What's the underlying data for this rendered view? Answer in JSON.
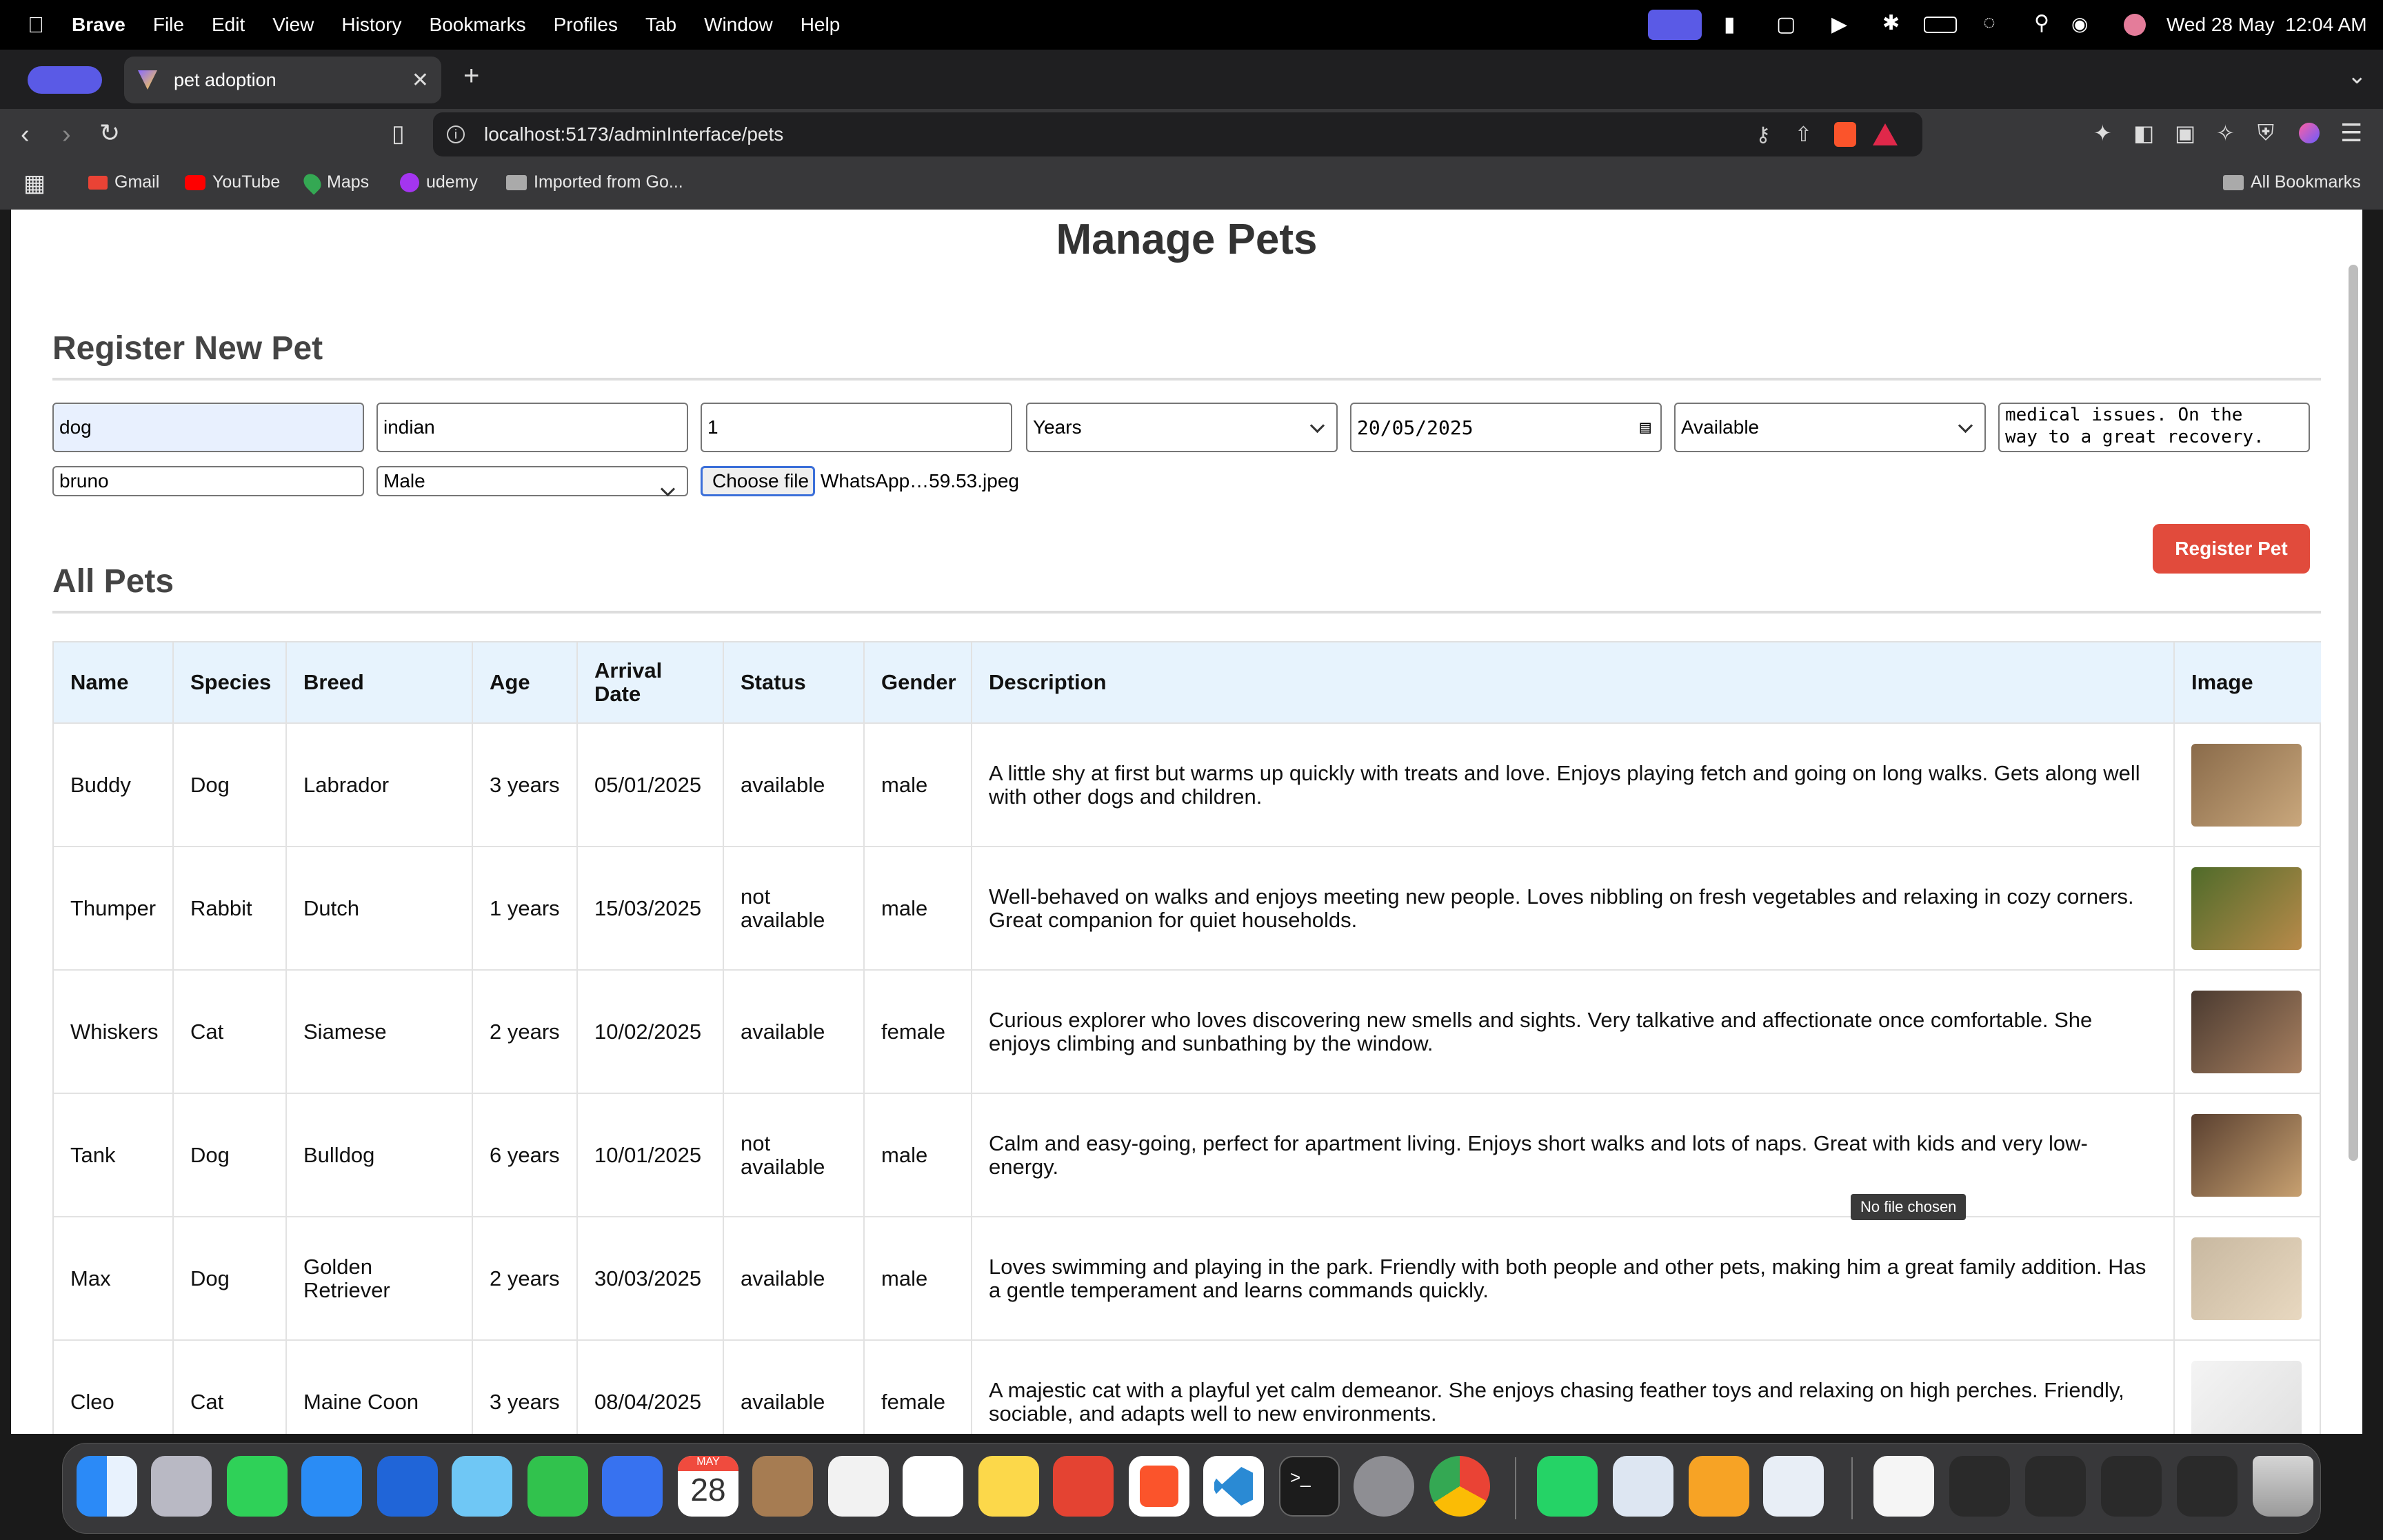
{
  "menubar": {
    "app": "Brave",
    "menus": [
      "File",
      "Edit",
      "View",
      "History",
      "Bookmarks",
      "Profiles",
      "Tab",
      "Window",
      "Help"
    ],
    "clock": "Wed 28 May  12:04 AM"
  },
  "tab": {
    "title": "pet adoption"
  },
  "url": "localhost:5173/adminInterface/pets",
  "bookmarks": [
    "Gmail",
    "YouTube",
    "Maps",
    "udemy",
    "Imported from Go...",
    "All Bookmarks"
  ],
  "page": {
    "title": "Manage Pets",
    "register_heading": "Register New Pet",
    "all_heading": "All Pets",
    "register_button": "Register Pet"
  },
  "form": {
    "species": "dog",
    "breed": "indian",
    "age": "1",
    "age_unit": "Years",
    "arrival": "20/05/2025",
    "status": "Available",
    "description": "medical issues. On the\nway to a great recovery.",
    "name": "bruno",
    "gender": "Male",
    "file_button": "Choose file",
    "file_name": "WhatsApp…59.53.jpeg",
    "tooltip": "No file chosen"
  },
  "table": {
    "headers": [
      "Name",
      "Species",
      "Breed",
      "Age",
      "Arrival Date",
      "Status",
      "Gender",
      "Description",
      "Image"
    ],
    "rows": [
      {
        "name": "Buddy",
        "species": "Dog",
        "breed": "Labrador",
        "age": "3 years",
        "arrival": "05/01/2025",
        "status": "available",
        "gender": "male",
        "description": "A little shy at first but warms up quickly with treats and love. Enjoys playing fetch and going on long walks. Gets along well with other dogs and children."
      },
      {
        "name": "Thumper",
        "species": "Rabbit",
        "breed": "Dutch",
        "age": "1 years",
        "arrival": "15/03/2025",
        "status": "not available",
        "gender": "male",
        "description": "Well-behaved on walks and enjoys meeting new people. Loves nibbling on fresh vegetables and relaxing in cozy corners. Great companion for quiet households."
      },
      {
        "name": "Whiskers",
        "species": "Cat",
        "breed": "Siamese",
        "age": "2 years",
        "arrival": "10/02/2025",
        "status": "available",
        "gender": "female",
        "description": "Curious explorer who loves discovering new smells and sights. Very talkative and affectionate once comfortable. She enjoys climbing and sunbathing by the window."
      },
      {
        "name": "Tank",
        "species": "Dog",
        "breed": "Bulldog",
        "age": "6 years",
        "arrival": "10/01/2025",
        "status": "not available",
        "gender": "male",
        "description": "Calm and easy-going, perfect for apartment living. Enjoys short walks and lots of naps. Great with kids and very low-energy."
      },
      {
        "name": "Max",
        "species": "Dog",
        "breed": "Golden Retriever",
        "age": "2 years",
        "arrival": "30/03/2025",
        "status": "available",
        "gender": "male",
        "description": "Loves swimming and playing in the park. Friendly with both people and other pets, making him a great family addition. Has a gentle temperament and learns commands quickly."
      },
      {
        "name": "Cleo",
        "species": "Cat",
        "breed": "Maine Coon",
        "age": "3 years",
        "arrival": "08/04/2025",
        "status": "available",
        "gender": "female",
        "description": "A majestic cat with a playful yet calm demeanor. She enjoys chasing feather toys and relaxing on high perches. Friendly, sociable, and adapts well to new environments."
      }
    ]
  },
  "dock": {
    "calendar_month": "MAY",
    "calendar_day": "28"
  },
  "colors": {
    "accent": "#e14b3c",
    "header_bg": "#e7f3fd"
  }
}
